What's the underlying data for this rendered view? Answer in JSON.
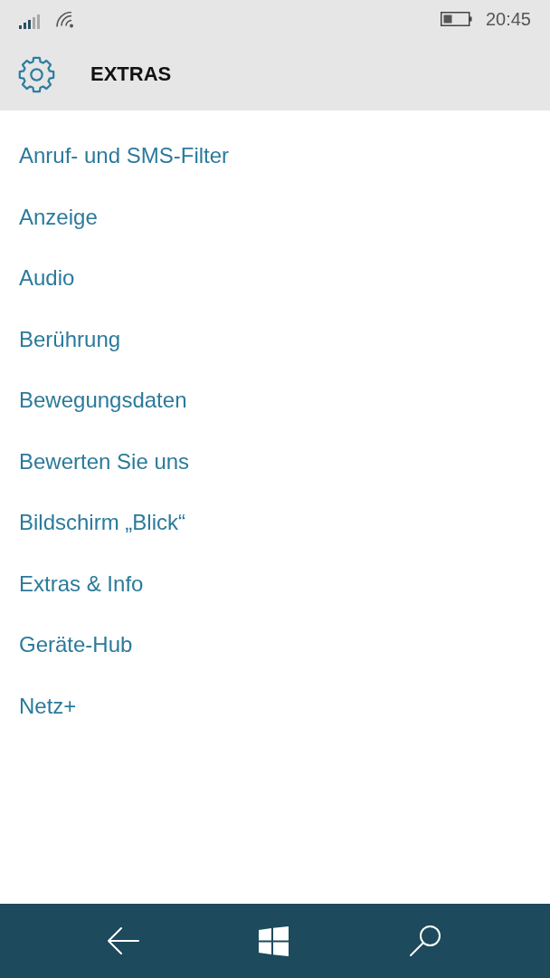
{
  "status_bar": {
    "time": "20:45"
  },
  "header": {
    "title": "EXTRAS"
  },
  "items": [
    {
      "label": "Anruf- und SMS-Filter"
    },
    {
      "label": "Anzeige"
    },
    {
      "label": "Audio"
    },
    {
      "label": "Berührung"
    },
    {
      "label": "Bewegungsdaten"
    },
    {
      "label": "Bewerten Sie uns"
    },
    {
      "label": "Bildschirm „Blick“"
    },
    {
      "label": "Extras & Info"
    },
    {
      "label": "Geräte-Hub"
    },
    {
      "label": "Netz+"
    }
  ]
}
